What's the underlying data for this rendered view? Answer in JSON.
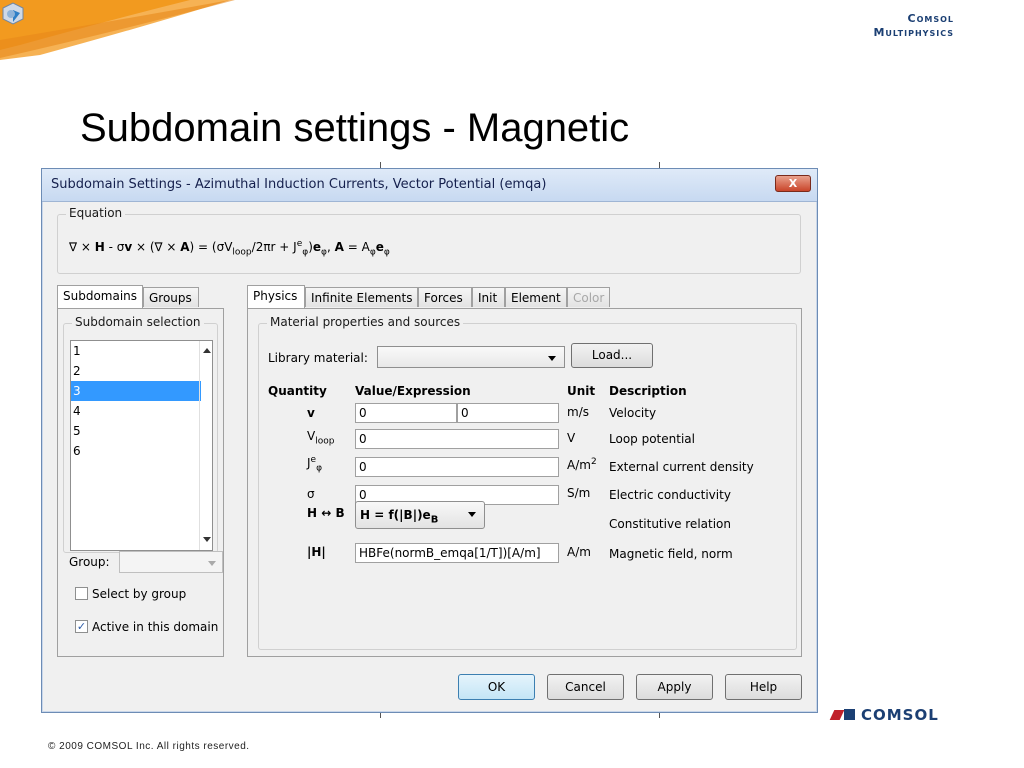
{
  "slide": {
    "title": "Subdomain settings - Magnetic",
    "brand_line1": "Comsol",
    "brand_line2": "Multiphysics",
    "footer_copyright": "© 2009 COMSOL Inc. All rights reserved.",
    "footer_logo": "COMSOL"
  },
  "dialog": {
    "title": "Subdomain Settings - Azimuthal Induction Currents, Vector Potential (emqa)",
    "close_label": "X",
    "equation_label": "Equation",
    "left_tabs": [
      "Subdomains",
      "Groups"
    ],
    "right_tabs": [
      "Physics",
      "Infinite Elements",
      "Forces",
      "Init",
      "Element",
      "Color"
    ],
    "subdomain_selection_label": "Subdomain selection",
    "subdomains": [
      "1",
      "2",
      "3",
      "4",
      "5",
      "6"
    ],
    "selected_subdomain": "3",
    "group_label": "Group:",
    "group_value": "",
    "select_by_group_label": "Select by group",
    "select_by_group_checked": false,
    "active_in_domain_label": "Active in this domain",
    "active_in_domain_checked": true,
    "material_group_label": "Material properties and sources",
    "library_material_label": "Library material:",
    "library_material_value": "",
    "load_button": "Load...",
    "headers": {
      "quantity": "Quantity",
      "value": "Value/Expression",
      "unit": "Unit",
      "description": "Description"
    },
    "rows": {
      "velocity": {
        "quantity": "v",
        "value1": "0",
        "value2": "0",
        "unit": "m/s",
        "description": "Velocity"
      },
      "loop": {
        "quantity": "V",
        "quantity_sub": "loop",
        "value": "0",
        "unit": "V",
        "description": "Loop potential"
      },
      "external": {
        "quantity": "J",
        "quantity_sup": "e",
        "quantity_sub": "φ",
        "value": "0",
        "unit": "A/m",
        "unit_sup": "2",
        "description": "External current density"
      },
      "sigma": {
        "quantity": "σ",
        "value": "0",
        "unit": "S/m",
        "description": "Electric conductivity"
      },
      "constitutive": {
        "quantity": "H ↔ B",
        "value_prefix": "H = f(|B|)e",
        "value_sub": "B",
        "unit": "",
        "description": "Constitutive relation"
      },
      "hnorm": {
        "quantity": "|H|",
        "value": "HBFe(normB_emqa[1/T])[A/m]",
        "unit": "A/m",
        "description": "Magnetic field, norm"
      }
    },
    "buttons": {
      "ok": "OK",
      "cancel": "Cancel",
      "apply": "Apply",
      "help": "Help"
    }
  },
  "colors": {
    "header_orange": "#f29a1f",
    "header_blue": "#1b3f73",
    "selection": "#3399ff",
    "logo_red": "#c0202a"
  }
}
